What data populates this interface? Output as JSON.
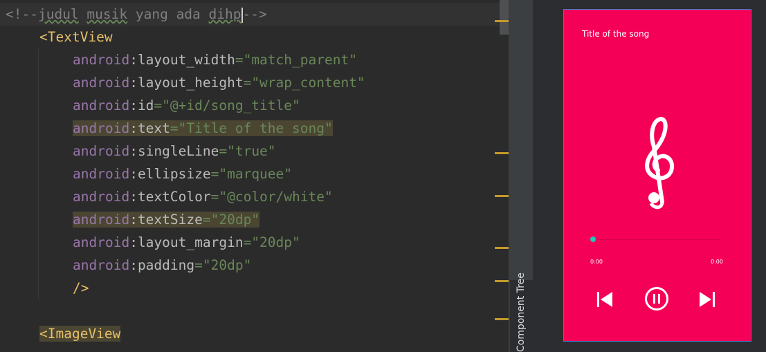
{
  "editor": {
    "comment": "<!--judul musik yang ada dihp-->",
    "comment_parts": {
      "open": "<!--",
      "w1": "judul",
      "s1": " ",
      "w2": "musik",
      "s2": " yang ada ",
      "w3": "dihp",
      "close": "-->"
    },
    "tag1": "<TextView",
    "attrs": [
      {
        "ns": "android",
        "name": "layout_width",
        "value": "\"match_parent\""
      },
      {
        "ns": "android",
        "name": "layout_height",
        "value": "\"wrap_content\""
      },
      {
        "ns": "android",
        "name": "id",
        "value": "\"@+id/song_title\""
      },
      {
        "ns": "android",
        "name": "text",
        "value": "\"Title of the song\""
      },
      {
        "ns": "android",
        "name": "singleLine",
        "value": "\"true\""
      },
      {
        "ns": "android",
        "name": "ellipsize",
        "value": "\"marquee\""
      },
      {
        "ns": "android",
        "name": "textColor",
        "value": "\"@color/white\""
      },
      {
        "ns": "android",
        "name": "textSize",
        "value": "\"20dp\""
      },
      {
        "ns": "android",
        "name": "layout_margin",
        "value": "\"20dp\""
      },
      {
        "ns": "android",
        "name": "padding",
        "value": "\"20dp\""
      }
    ],
    "close": "/>",
    "tag2": "<ImageView",
    "colon": ":",
    "eq": "="
  },
  "side_panel": {
    "label": "Component Tree"
  },
  "preview": {
    "song_title": "Title of the song",
    "time_current": "0:00",
    "time_total": "0:00",
    "progress": 0,
    "background_color": "#f50057",
    "accent_color": "#1ec8b8"
  }
}
